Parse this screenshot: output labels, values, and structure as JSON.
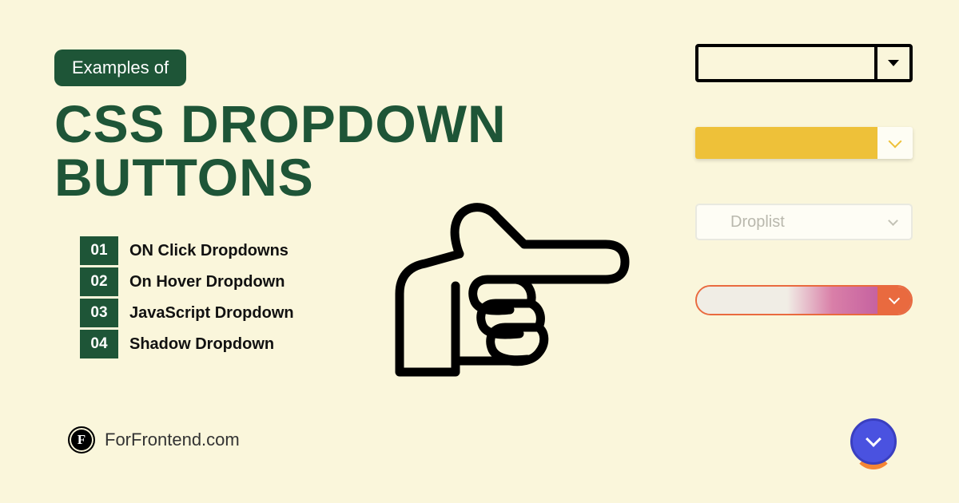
{
  "badge": "Examples of",
  "title_line1": "CSS DROPDOWN",
  "title_line2": "BUTTONS",
  "list": [
    {
      "num": "01",
      "label": "ON Click Dropdowns"
    },
    {
      "num": "02",
      "label": "On Hover Dropdown"
    },
    {
      "num": "03",
      "label": "JavaScript Dropdown"
    },
    {
      "num": "04",
      "label": "Shadow Dropdown"
    }
  ],
  "brand": "ForFrontend.com",
  "brand_mark": "F",
  "example3_label": "Droplist",
  "colors": {
    "primary_green": "#1e5537",
    "bg": "#faf6db",
    "yellow": "#eec139",
    "orange": "#e96a3f",
    "blue": "#4a52e0"
  }
}
